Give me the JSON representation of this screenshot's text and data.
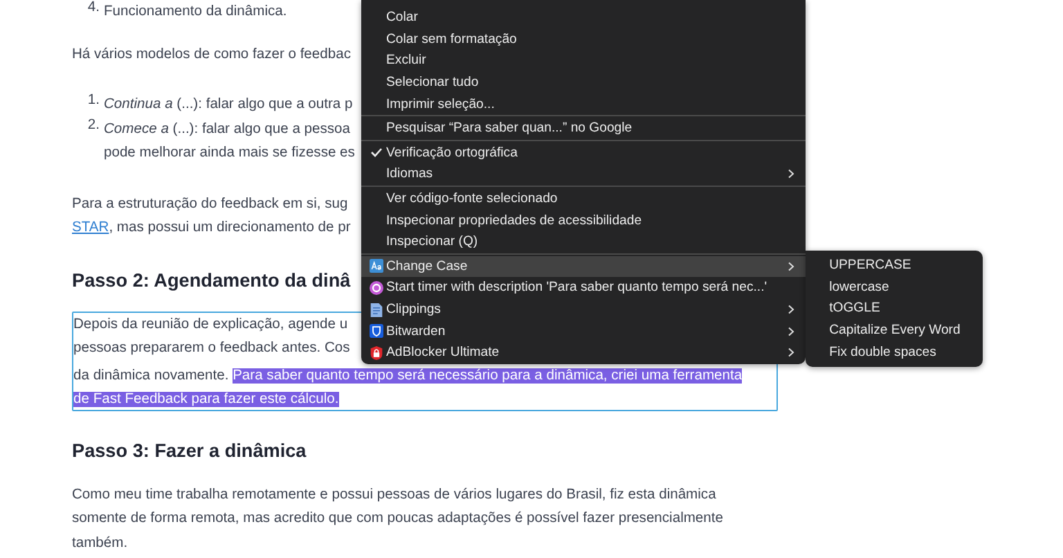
{
  "article": {
    "blocks": [
      {
        "kind": "list",
        "items": [
          {
            "number": "4.",
            "lines": [
              "Funcionamento da dinâmica."
            ]
          }
        ]
      },
      {
        "kind": "paragraph",
        "outlined": false,
        "lines": [
          [
            {
              "kind": "plain",
              "text": "Há vários modelos de como fazer o feedbac"
            }
          ]
        ]
      },
      {
        "kind": "list",
        "items": [
          {
            "number": "1.",
            "lines": [
              "*Continua a* (...): falar algo que a outra p"
            ]
          },
          {
            "number": "2.",
            "lines": [
              "*Comece a* (...): falar algo que a pessoa",
              "pode melhorar ainda mais se fizesse es"
            ]
          }
        ]
      },
      {
        "kind": "paragraph",
        "outlined": false,
        "lines": [
          [
            {
              "kind": "plain",
              "text": "Para a estruturação do feedback em si, sug"
            }
          ],
          [
            {
              "kind": "link",
              "text": "STAR"
            },
            {
              "kind": "plain",
              "text": ", mas possui um direcionamento de pr"
            }
          ]
        ]
      },
      {
        "kind": "heading",
        "text": "Passo 2: Agendamento da dinâ"
      },
      {
        "kind": "paragraph",
        "outlined": true,
        "lines": [
          [
            {
              "kind": "plain",
              "text": "Depois da reunião de explicação, agende u"
            }
          ],
          [
            {
              "kind": "plain",
              "text": "pessoas prepararem o feedback antes. Cos"
            }
          ],
          [
            {
              "kind": "plain",
              "text": "da dinâmica novamente. "
            },
            {
              "kind": "highlight",
              "text": "Para saber quanto tempo será necessário para a dinâmica, criei uma ferramenta"
            }
          ],
          [
            {
              "kind": "highlight",
              "text": "de Fast Feedback para fazer este cálculo."
            }
          ]
        ]
      },
      {
        "kind": "heading",
        "text": "Passo 3: Fazer a dinâmica"
      },
      {
        "kind": "paragraph",
        "outlined": false,
        "lines": [
          [
            {
              "kind": "plain",
              "text": "Como meu time trabalha remotamente e possui pessoas de vários lugares do Brasil, fiz esta dinâmica"
            }
          ],
          [
            {
              "kind": "plain",
              "text": "somente de forma remota, mas acredito que com poucas adaptações é possível fazer presencialmente"
            }
          ],
          [
            {
              "kind": "plain",
              "text": "também."
            }
          ]
        ]
      }
    ]
  },
  "context_menu": {
    "items": [
      {
        "kind": "command",
        "label": "Colar",
        "checked": false,
        "submenu": false,
        "selected": false
      },
      {
        "kind": "command",
        "label": "Colar sem formatação",
        "checked": false,
        "submenu": false,
        "selected": false
      },
      {
        "kind": "command",
        "label": "Excluir",
        "checked": false,
        "submenu": false,
        "selected": false
      },
      {
        "kind": "command",
        "label": "Selecionar tudo",
        "checked": false,
        "submenu": false,
        "selected": false
      },
      {
        "kind": "command",
        "label": "Imprimir seleção...",
        "checked": false,
        "submenu": false,
        "selected": false
      },
      {
        "kind": "separator"
      },
      {
        "kind": "command",
        "label": "Pesquisar “Para saber quan...” no Google",
        "checked": false,
        "submenu": false,
        "selected": false
      },
      {
        "kind": "separator"
      },
      {
        "kind": "command",
        "label": "Verificação ortográfica",
        "checked": true,
        "submenu": false,
        "selected": false
      },
      {
        "kind": "command",
        "label": "Idiomas",
        "checked": false,
        "submenu": true,
        "selected": false
      },
      {
        "kind": "separator"
      },
      {
        "kind": "command",
        "label": "Ver código-fonte selecionado",
        "checked": false,
        "submenu": false,
        "selected": false
      },
      {
        "kind": "command",
        "label": "Inspecionar propriedades de acessibilidade",
        "checked": false,
        "submenu": false,
        "selected": false
      },
      {
        "kind": "command",
        "label": "Inspecionar (Q)",
        "checked": false,
        "submenu": false,
        "selected": false
      },
      {
        "kind": "separator"
      },
      {
        "kind": "extension",
        "label": "Change Case",
        "checked": false,
        "submenu": true,
        "selected": true
      },
      {
        "kind": "extension",
        "label": "Start timer with description 'Para saber quanto tempo será nec...'",
        "checked": false,
        "submenu": false,
        "selected": false
      },
      {
        "kind": "extension",
        "label": "Clippings",
        "checked": false,
        "submenu": true,
        "selected": false
      },
      {
        "kind": "extension",
        "label": "Bitwarden",
        "checked": false,
        "submenu": true,
        "selected": false
      },
      {
        "kind": "extension",
        "label": "AdBlocker Ultimate",
        "checked": false,
        "submenu": true,
        "selected": false
      }
    ]
  },
  "submenu": {
    "items": [
      {
        "label": "UPPERCASE",
        "selected": false
      },
      {
        "label": "lowercase",
        "selected": false
      },
      {
        "label": "tOGGLE",
        "selected": false
      },
      {
        "label": "Capitalize Every Word",
        "selected": false
      },
      {
        "label": "Fix double spaces",
        "selected": false
      }
    ]
  }
}
